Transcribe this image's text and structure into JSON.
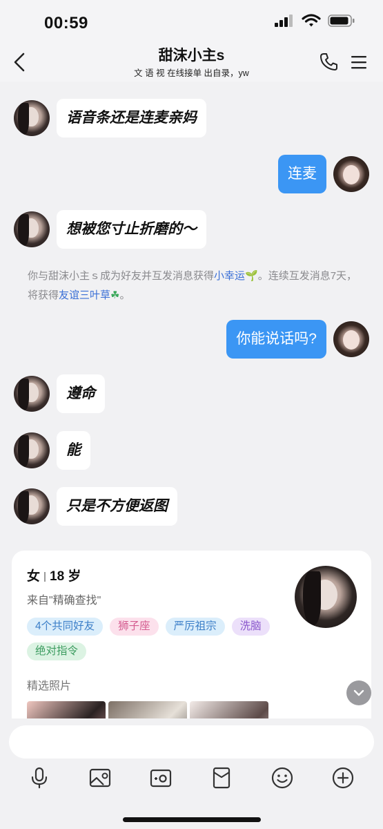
{
  "status_bar": {
    "time": "00:59"
  },
  "header": {
    "title": "甜沫小主s",
    "subtitle": "文 语 视  在线接单  出自录，yw"
  },
  "messages": [
    {
      "side": "in",
      "text": "语音条还是连麦亲妈"
    },
    {
      "side": "out",
      "text": "连麦"
    },
    {
      "side": "in",
      "text": "想被您寸止折磨的～"
    },
    {
      "side": "out",
      "text": "你能说话吗?"
    },
    {
      "side": "in",
      "text": "遵命"
    },
    {
      "side": "in",
      "text": "能"
    },
    {
      "side": "in",
      "text": "只是不方便返图"
    }
  ],
  "system_notice": {
    "part1": "你与甜沫小主ｓ成为好友并互发消息获得",
    "link1": "小幸运",
    "emoji1": "🌱",
    "part2": "。连续互发消息7天，将获得",
    "link2": "友谊三叶草",
    "emoji2": "☘",
    "part3": "。"
  },
  "profile_card": {
    "gender": "女",
    "age": "18 岁",
    "origin": "来自\"精确查找\"",
    "tags": [
      {
        "label": "4个共同好友",
        "color": "blue"
      },
      {
        "label": "狮子座",
        "color": "pink"
      },
      {
        "label": "严厉祖宗",
        "color": "blue"
      },
      {
        "label": "洗脑",
        "color": "purple"
      },
      {
        "label": "绝对指令",
        "color": "green"
      }
    ],
    "photos_label": "精选照片"
  },
  "input": {
    "placeholder": ""
  },
  "toolbar": [
    "microphone-icon",
    "image-icon",
    "camera-icon",
    "red-packet-icon",
    "emoji-icon",
    "plus-icon"
  ],
  "colors": {
    "outgoing_bubble": "#3b96f4",
    "link": "#3a6fd6"
  }
}
